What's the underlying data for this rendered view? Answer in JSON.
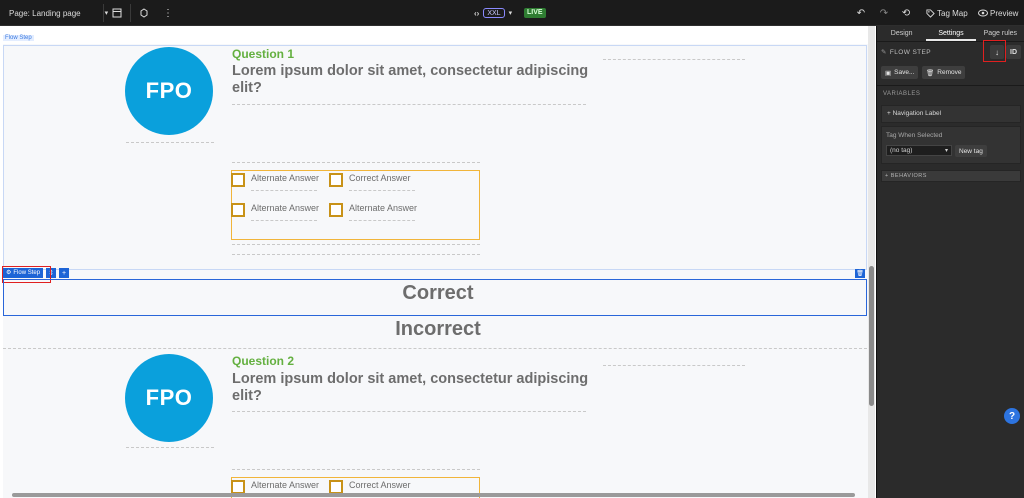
{
  "topbar": {
    "page_label": "Page: Landing page",
    "size_badge": "XXL",
    "live_badge": "LIVE",
    "tag_map_label": "Tag Map",
    "preview_label": "Preview"
  },
  "canvas": {
    "flow_step_tag": "Flow Step",
    "selected_chip": "Flow Step",
    "step1": {
      "avatar_text": "FPO",
      "question_number": "Question 1",
      "question_text": "Lorem ipsum dolor sit amet, consectetur adipiscing elit?",
      "answers": [
        "Alternate Answer",
        "Correct Answer",
        "Alternate Answer",
        "Alternate Answer"
      ]
    },
    "correct_label": "Correct",
    "incorrect_label": "Incorrect",
    "step2": {
      "avatar_text": "FPO",
      "question_number": "Question 2",
      "question_text": "Lorem ipsum dolor sit amet, consectetur adipiscing elit?",
      "answers": [
        "Alternate Answer",
        "Correct Answer"
      ]
    }
  },
  "panel": {
    "tabs": [
      "Design",
      "Settings",
      "Page rules"
    ],
    "active_tab": "Settings",
    "section_title": "FLOW STEP",
    "id_button": "ID",
    "save_button": "Save...",
    "remove_button": "Remove",
    "variables_title": "VARIABLES",
    "navigation_label": "+ Navigation Label",
    "tag_when_selected": "Tag When Selected",
    "tag_select_value": "(no tag)",
    "new_tag_button": "New tag",
    "behaviors_title": "+ BEHAVIORS"
  },
  "help_label": "?",
  "colors": {
    "accent": "#1d64d6",
    "fpo": "#0aa0dc",
    "question_number": "#64b040",
    "answer_border": "#f1b53a",
    "highlight": "#e02020",
    "live": "#2f7d32"
  }
}
